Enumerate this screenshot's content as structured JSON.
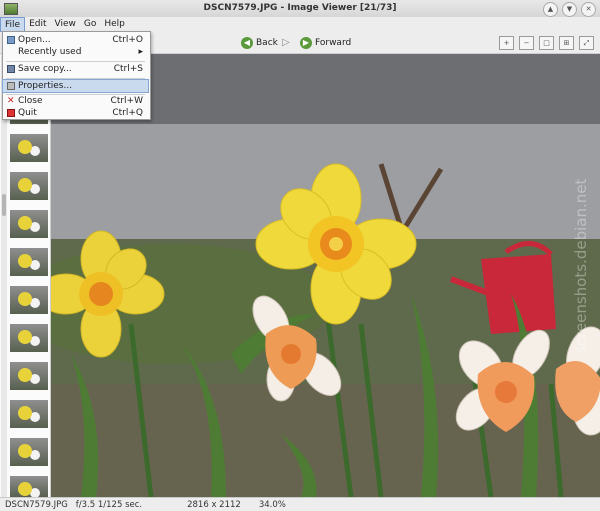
{
  "window": {
    "title": "DSCN7579.JPG - Image Viewer [21/73]"
  },
  "menubar": {
    "items": [
      "File",
      "Edit",
      "View",
      "Go",
      "Help"
    ]
  },
  "toolbar": {
    "back": "Back",
    "forward": "Forward"
  },
  "file_menu": {
    "items": [
      {
        "label": "Open...",
        "accel": "Ctrl+O",
        "icon": "open-icon"
      },
      {
        "label": "Recently used",
        "accel": "▸",
        "icon": ""
      },
      {
        "label": "Save copy...",
        "accel": "Ctrl+S",
        "icon": "save-icon"
      },
      {
        "label": "Properties...",
        "accel": "",
        "icon": "properties-icon"
      },
      {
        "label": "Close",
        "accel": "Ctrl+W",
        "icon": "close-icon"
      },
      {
        "label": "Quit",
        "accel": "Ctrl+Q",
        "icon": "quit-icon"
      }
    ]
  },
  "watermark": "screenshots.debian.net",
  "status": {
    "filename": "DSCN7579.JPG",
    "exposure": "f/3.5  1/125 sec.",
    "dimensions": "2816 x 2112",
    "zoom": "34.0%"
  }
}
